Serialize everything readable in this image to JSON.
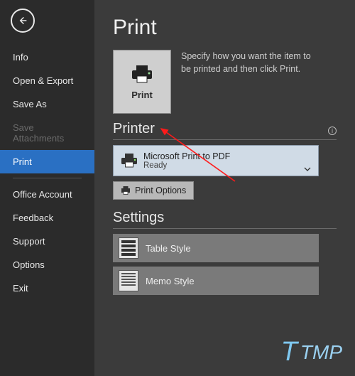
{
  "backstage": {
    "back_tooltip": "Back",
    "nav": [
      {
        "label": "Info",
        "state": "normal"
      },
      {
        "label": "Open & Export",
        "state": "normal"
      },
      {
        "label": "Save As",
        "state": "normal"
      },
      {
        "label": "Save Attachments",
        "state": "disabled"
      },
      {
        "label": "Print",
        "state": "selected"
      },
      {
        "label": "Office Account",
        "state": "normal"
      },
      {
        "label": "Feedback",
        "state": "normal"
      },
      {
        "label": "Support",
        "state": "normal"
      },
      {
        "label": "Options",
        "state": "normal"
      },
      {
        "label": "Exit",
        "state": "normal"
      }
    ]
  },
  "page": {
    "title": "Print"
  },
  "print_tile": {
    "label": "Print"
  },
  "help_text": "Specify how you want the item to be printed and then click Print.",
  "printer_section": {
    "heading": "Printer",
    "selected_printer": "Microsoft Print to PDF",
    "status": "Ready",
    "options_button": "Print Options"
  },
  "settings_section": {
    "heading": "Settings",
    "styles": [
      {
        "label": "Table Style",
        "thumb": "table"
      },
      {
        "label": "Memo Style",
        "thumb": "memo"
      }
    ]
  },
  "watermark": {
    "text": "TMP"
  }
}
